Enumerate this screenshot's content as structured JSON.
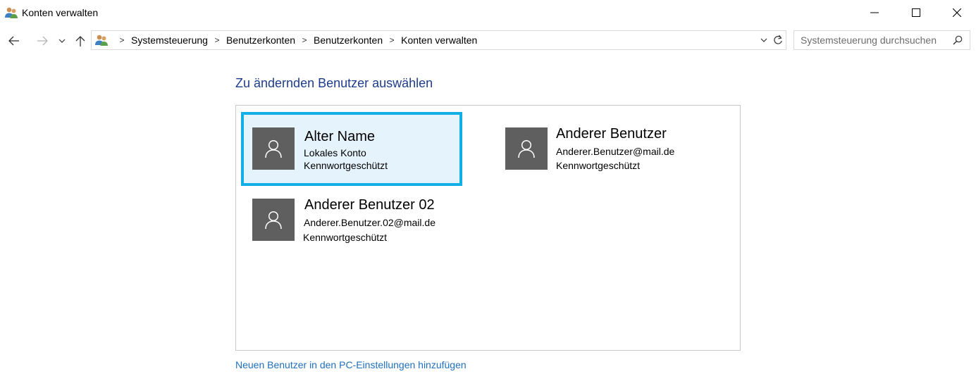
{
  "window": {
    "title": "Konten verwalten",
    "icon": "users-icon"
  },
  "nav": {
    "breadcrumbs": [
      "Systemsteuerung",
      "Benutzerkonten",
      "Benutzerkonten",
      "Konten verwalten"
    ],
    "search_placeholder": "Systemsteuerung durchsuchen"
  },
  "main": {
    "heading": "Zu ändernden Benutzer auswählen",
    "users": [
      {
        "name": "Alter Name",
        "line1": "Lokales Konto",
        "line2": "Kennwortgeschützt",
        "selected": true
      },
      {
        "name": "Anderer Benutzer",
        "line1": "Anderer.Benutzer@mail.de",
        "line2": "Kennwortgeschützt",
        "selected": false
      },
      {
        "name": "Anderer Benutzer 02",
        "line1": "Anderer.Benutzer.02@mail.de",
        "line2": "Kennwortgeschützt",
        "selected": false
      }
    ],
    "add_user_link": "Neuen Benutzer in den PC-Einstellungen hinzufügen"
  },
  "colors": {
    "heading": "#1e3c8c",
    "link": "#1f6fbf",
    "selection_border": "#12aee6",
    "selection_fill": "#e5f3fd",
    "avatar_bg": "#5f5f5f"
  }
}
